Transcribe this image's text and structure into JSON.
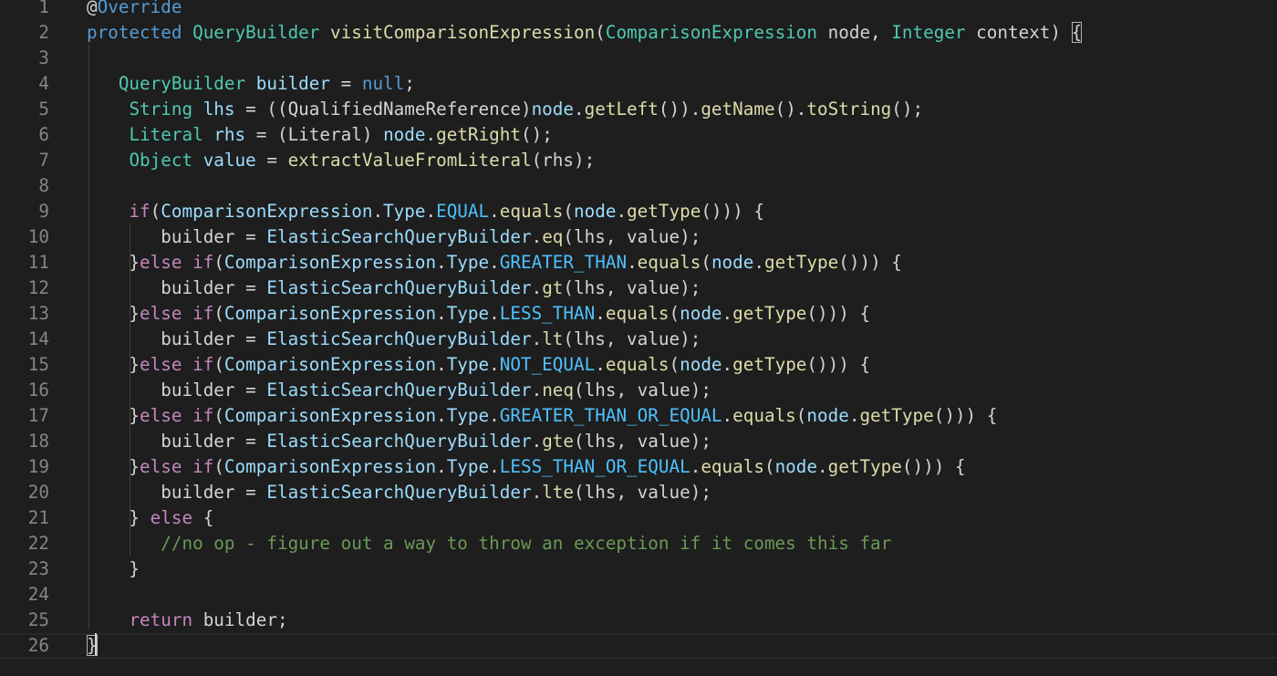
{
  "editor": {
    "lines": [
      {
        "n": "1",
        "tokens": [
          {
            "c": "t-plain",
            "t": "@"
          },
          {
            "c": "t-kw",
            "t": "Override"
          }
        ]
      },
      {
        "n": "2",
        "tokens": [
          {
            "c": "t-kw",
            "t": "protected"
          },
          {
            "c": "t-plain",
            "t": " "
          },
          {
            "c": "t-type",
            "t": "QueryBuilder"
          },
          {
            "c": "t-plain",
            "t": " "
          },
          {
            "c": "t-fn",
            "t": "visitComparisonExpression"
          },
          {
            "c": "t-plain",
            "t": "("
          },
          {
            "c": "t-type",
            "t": "ComparisonExpression"
          },
          {
            "c": "t-plain",
            "t": " node, "
          },
          {
            "c": "t-type",
            "t": "Integer"
          },
          {
            "c": "t-plain",
            "t": " context) "
          },
          {
            "c": "t-plain bracket-match",
            "t": "{"
          }
        ]
      },
      {
        "n": "3",
        "tokens": []
      },
      {
        "n": "4",
        "tokens": [
          {
            "c": "t-plain",
            "t": "   "
          },
          {
            "c": "t-type",
            "t": "QueryBuilder"
          },
          {
            "c": "t-plain",
            "t": " "
          },
          {
            "c": "t-var",
            "t": "builder"
          },
          {
            "c": "t-plain",
            "t": " = "
          },
          {
            "c": "t-kw",
            "t": "null"
          },
          {
            "c": "t-plain",
            "t": ";"
          }
        ]
      },
      {
        "n": "5",
        "tokens": [
          {
            "c": "t-plain",
            "t": "    "
          },
          {
            "c": "t-type",
            "t": "String"
          },
          {
            "c": "t-plain",
            "t": " "
          },
          {
            "c": "t-var",
            "t": "lhs"
          },
          {
            "c": "t-plain",
            "t": " = ((QualifiedNameReference)"
          },
          {
            "c": "t-var",
            "t": "node"
          },
          {
            "c": "t-plain",
            "t": "."
          },
          {
            "c": "t-fn",
            "t": "getLeft"
          },
          {
            "c": "t-plain",
            "t": "())."
          },
          {
            "c": "t-fn",
            "t": "getName"
          },
          {
            "c": "t-plain",
            "t": "()."
          },
          {
            "c": "t-fn",
            "t": "toString"
          },
          {
            "c": "t-plain",
            "t": "();"
          }
        ]
      },
      {
        "n": "6",
        "tokens": [
          {
            "c": "t-plain",
            "t": "    "
          },
          {
            "c": "t-type",
            "t": "Literal"
          },
          {
            "c": "t-plain",
            "t": " "
          },
          {
            "c": "t-var",
            "t": "rhs"
          },
          {
            "c": "t-plain",
            "t": " = (Literal) "
          },
          {
            "c": "t-var",
            "t": "node"
          },
          {
            "c": "t-plain",
            "t": "."
          },
          {
            "c": "t-fn",
            "t": "getRight"
          },
          {
            "c": "t-plain",
            "t": "();"
          }
        ]
      },
      {
        "n": "7",
        "tokens": [
          {
            "c": "t-plain",
            "t": "    "
          },
          {
            "c": "t-type",
            "t": "Object"
          },
          {
            "c": "t-plain",
            "t": " "
          },
          {
            "c": "t-var",
            "t": "value"
          },
          {
            "c": "t-plain",
            "t": " = "
          },
          {
            "c": "t-fn",
            "t": "extractValueFromLiteral"
          },
          {
            "c": "t-plain",
            "t": "(rhs);"
          }
        ]
      },
      {
        "n": "8",
        "tokens": []
      },
      {
        "n": "9",
        "tokens": [
          {
            "c": "t-plain",
            "t": "    "
          },
          {
            "c": "t-ctl",
            "t": "if"
          },
          {
            "c": "t-plain",
            "t": "("
          },
          {
            "c": "t-var",
            "t": "ComparisonExpression"
          },
          {
            "c": "t-plain",
            "t": "."
          },
          {
            "c": "t-var",
            "t": "Type"
          },
          {
            "c": "t-plain",
            "t": "."
          },
          {
            "c": "t-const",
            "t": "EQUAL"
          },
          {
            "c": "t-plain",
            "t": "."
          },
          {
            "c": "t-fn",
            "t": "equals"
          },
          {
            "c": "t-plain",
            "t": "("
          },
          {
            "c": "t-var",
            "t": "node"
          },
          {
            "c": "t-plain",
            "t": "."
          },
          {
            "c": "t-fn",
            "t": "getType"
          },
          {
            "c": "t-plain",
            "t": "())) {"
          }
        ]
      },
      {
        "n": "10",
        "tokens": [
          {
            "c": "t-plain",
            "t": "       "
          },
          {
            "c": "t-plain",
            "t": "builder = "
          },
          {
            "c": "t-var",
            "t": "ElasticSearchQueryBuilder"
          },
          {
            "c": "t-plain",
            "t": "."
          },
          {
            "c": "t-fn",
            "t": "eq"
          },
          {
            "c": "t-plain",
            "t": "(lhs, value);"
          }
        ]
      },
      {
        "n": "11",
        "tokens": [
          {
            "c": "t-plain",
            "t": "    }"
          },
          {
            "c": "t-ctl",
            "t": "else"
          },
          {
            "c": "t-plain",
            "t": " "
          },
          {
            "c": "t-ctl",
            "t": "if"
          },
          {
            "c": "t-plain",
            "t": "("
          },
          {
            "c": "t-var",
            "t": "ComparisonExpression"
          },
          {
            "c": "t-plain",
            "t": "."
          },
          {
            "c": "t-var",
            "t": "Type"
          },
          {
            "c": "t-plain",
            "t": "."
          },
          {
            "c": "t-const",
            "t": "GREATER_THAN"
          },
          {
            "c": "t-plain",
            "t": "."
          },
          {
            "c": "t-fn",
            "t": "equals"
          },
          {
            "c": "t-plain",
            "t": "("
          },
          {
            "c": "t-var",
            "t": "node"
          },
          {
            "c": "t-plain",
            "t": "."
          },
          {
            "c": "t-fn",
            "t": "getType"
          },
          {
            "c": "t-plain",
            "t": "())) {"
          }
        ]
      },
      {
        "n": "12",
        "tokens": [
          {
            "c": "t-plain",
            "t": "       "
          },
          {
            "c": "t-plain",
            "t": "builder = "
          },
          {
            "c": "t-var",
            "t": "ElasticSearchQueryBuilder"
          },
          {
            "c": "t-plain",
            "t": "."
          },
          {
            "c": "t-fn",
            "t": "gt"
          },
          {
            "c": "t-plain",
            "t": "(lhs, value);"
          }
        ]
      },
      {
        "n": "13",
        "tokens": [
          {
            "c": "t-plain",
            "t": "    }"
          },
          {
            "c": "t-ctl",
            "t": "else"
          },
          {
            "c": "t-plain",
            "t": " "
          },
          {
            "c": "t-ctl",
            "t": "if"
          },
          {
            "c": "t-plain",
            "t": "("
          },
          {
            "c": "t-var",
            "t": "ComparisonExpression"
          },
          {
            "c": "t-plain",
            "t": "."
          },
          {
            "c": "t-var",
            "t": "Type"
          },
          {
            "c": "t-plain",
            "t": "."
          },
          {
            "c": "t-const",
            "t": "LESS_THAN"
          },
          {
            "c": "t-plain",
            "t": "."
          },
          {
            "c": "t-fn",
            "t": "equals"
          },
          {
            "c": "t-plain",
            "t": "("
          },
          {
            "c": "t-var",
            "t": "node"
          },
          {
            "c": "t-plain",
            "t": "."
          },
          {
            "c": "t-fn",
            "t": "getType"
          },
          {
            "c": "t-plain",
            "t": "())) {"
          }
        ]
      },
      {
        "n": "14",
        "tokens": [
          {
            "c": "t-plain",
            "t": "       "
          },
          {
            "c": "t-plain",
            "t": "builder = "
          },
          {
            "c": "t-var",
            "t": "ElasticSearchQueryBuilder"
          },
          {
            "c": "t-plain",
            "t": "."
          },
          {
            "c": "t-fn",
            "t": "lt"
          },
          {
            "c": "t-plain",
            "t": "(lhs, value);"
          }
        ]
      },
      {
        "n": "15",
        "tokens": [
          {
            "c": "t-plain",
            "t": "    }"
          },
          {
            "c": "t-ctl",
            "t": "else"
          },
          {
            "c": "t-plain",
            "t": " "
          },
          {
            "c": "t-ctl",
            "t": "if"
          },
          {
            "c": "t-plain",
            "t": "("
          },
          {
            "c": "t-var",
            "t": "ComparisonExpression"
          },
          {
            "c": "t-plain",
            "t": "."
          },
          {
            "c": "t-var",
            "t": "Type"
          },
          {
            "c": "t-plain",
            "t": "."
          },
          {
            "c": "t-const",
            "t": "NOT_EQUAL"
          },
          {
            "c": "t-plain",
            "t": "."
          },
          {
            "c": "t-fn",
            "t": "equals"
          },
          {
            "c": "t-plain",
            "t": "("
          },
          {
            "c": "t-var",
            "t": "node"
          },
          {
            "c": "t-plain",
            "t": "."
          },
          {
            "c": "t-fn",
            "t": "getType"
          },
          {
            "c": "t-plain",
            "t": "())) {"
          }
        ]
      },
      {
        "n": "16",
        "tokens": [
          {
            "c": "t-plain",
            "t": "       "
          },
          {
            "c": "t-plain",
            "t": "builder = "
          },
          {
            "c": "t-var",
            "t": "ElasticSearchQueryBuilder"
          },
          {
            "c": "t-plain",
            "t": "."
          },
          {
            "c": "t-fn",
            "t": "neq"
          },
          {
            "c": "t-plain",
            "t": "(lhs, value);"
          }
        ]
      },
      {
        "n": "17",
        "tokens": [
          {
            "c": "t-plain",
            "t": "    }"
          },
          {
            "c": "t-ctl",
            "t": "else"
          },
          {
            "c": "t-plain",
            "t": " "
          },
          {
            "c": "t-ctl",
            "t": "if"
          },
          {
            "c": "t-plain",
            "t": "("
          },
          {
            "c": "t-var",
            "t": "ComparisonExpression"
          },
          {
            "c": "t-plain",
            "t": "."
          },
          {
            "c": "t-var",
            "t": "Type"
          },
          {
            "c": "t-plain",
            "t": "."
          },
          {
            "c": "t-const",
            "t": "GREATER_THAN_OR_EQUAL"
          },
          {
            "c": "t-plain",
            "t": "."
          },
          {
            "c": "t-fn",
            "t": "equals"
          },
          {
            "c": "t-plain",
            "t": "("
          },
          {
            "c": "t-var",
            "t": "node"
          },
          {
            "c": "t-plain",
            "t": "."
          },
          {
            "c": "t-fn",
            "t": "getType"
          },
          {
            "c": "t-plain",
            "t": "())) {"
          }
        ]
      },
      {
        "n": "18",
        "tokens": [
          {
            "c": "t-plain",
            "t": "       "
          },
          {
            "c": "t-plain",
            "t": "builder = "
          },
          {
            "c": "t-var",
            "t": "ElasticSearchQueryBuilder"
          },
          {
            "c": "t-plain",
            "t": "."
          },
          {
            "c": "t-fn",
            "t": "gte"
          },
          {
            "c": "t-plain",
            "t": "(lhs, value);"
          }
        ]
      },
      {
        "n": "19",
        "tokens": [
          {
            "c": "t-plain",
            "t": "    }"
          },
          {
            "c": "t-ctl",
            "t": "else"
          },
          {
            "c": "t-plain",
            "t": " "
          },
          {
            "c": "t-ctl",
            "t": "if"
          },
          {
            "c": "t-plain",
            "t": "("
          },
          {
            "c": "t-var",
            "t": "ComparisonExpression"
          },
          {
            "c": "t-plain",
            "t": "."
          },
          {
            "c": "t-var",
            "t": "Type"
          },
          {
            "c": "t-plain",
            "t": "."
          },
          {
            "c": "t-const",
            "t": "LESS_THAN_OR_EQUAL"
          },
          {
            "c": "t-plain",
            "t": "."
          },
          {
            "c": "t-fn",
            "t": "equals"
          },
          {
            "c": "t-plain",
            "t": "("
          },
          {
            "c": "t-var",
            "t": "node"
          },
          {
            "c": "t-plain",
            "t": "."
          },
          {
            "c": "t-fn",
            "t": "getType"
          },
          {
            "c": "t-plain",
            "t": "())) {"
          }
        ]
      },
      {
        "n": "20",
        "tokens": [
          {
            "c": "t-plain",
            "t": "       "
          },
          {
            "c": "t-plain",
            "t": "builder = "
          },
          {
            "c": "t-var",
            "t": "ElasticSearchQueryBuilder"
          },
          {
            "c": "t-plain",
            "t": "."
          },
          {
            "c": "t-fn",
            "t": "lte"
          },
          {
            "c": "t-plain",
            "t": "(lhs, value);"
          }
        ]
      },
      {
        "n": "21",
        "tokens": [
          {
            "c": "t-plain",
            "t": "    } "
          },
          {
            "c": "t-ctl",
            "t": "else"
          },
          {
            "c": "t-plain",
            "t": " {"
          }
        ]
      },
      {
        "n": "22",
        "tokens": [
          {
            "c": "t-plain",
            "t": "       "
          },
          {
            "c": "t-cm",
            "t": "//no op - figure out a way to throw an exception if it comes this far"
          }
        ]
      },
      {
        "n": "23",
        "tokens": [
          {
            "c": "t-plain",
            "t": "    }"
          }
        ]
      },
      {
        "n": "24",
        "tokens": []
      },
      {
        "n": "25",
        "tokens": [
          {
            "c": "t-plain",
            "t": "    "
          },
          {
            "c": "t-ctl",
            "t": "return"
          },
          {
            "c": "t-plain",
            "t": " builder;"
          }
        ]
      },
      {
        "n": "26",
        "tokens": [
          {
            "c": "t-plain bracket-match",
            "t": "}"
          }
        ]
      }
    ]
  }
}
